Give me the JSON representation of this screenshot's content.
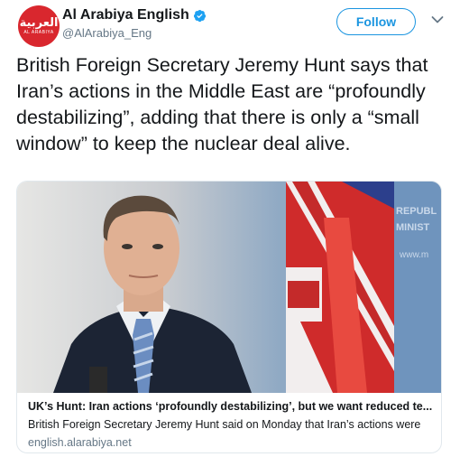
{
  "account": {
    "avatar_logo_ar": "العربية",
    "avatar_logo_en": "AL ARABIYA",
    "display_name": "Al Arabiya English",
    "verified_icon": "verified-badge-icon",
    "handle": "@AlArabiya_Eng"
  },
  "actions": {
    "follow_label": "Follow",
    "menu_icon": "chevron-down-icon"
  },
  "tweet": {
    "text": "British Foreign Secretary Jeremy Hunt says that Iran’s actions in the Middle East are “profoundly destabilizing”, adding that there is only a “small window” to keep the nuclear deal alive."
  },
  "card": {
    "image_sign_line1": "REPUBL",
    "image_sign_line2": "MINIST",
    "image_sign_line3": "www.m",
    "title": "UK’s Hunt: Iran actions ‘profoundly destabilizing’, but we want reduced te...",
    "description": "British Foreign Secretary Jeremy Hunt said on Monday that Iran’s actions were",
    "domain": "english.alarabiya.net"
  },
  "colors": {
    "accent": "#1b95e0",
    "brand_red": "#d9272e",
    "secondary_text": "#657786"
  }
}
